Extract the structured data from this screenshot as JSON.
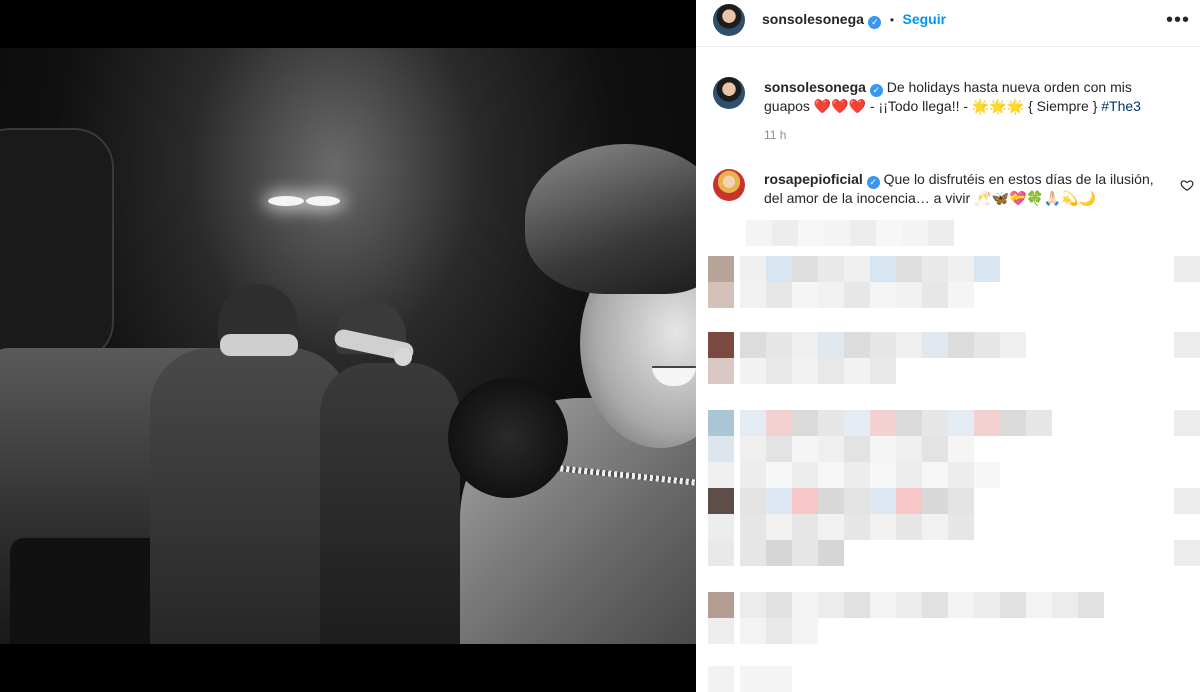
{
  "post": {
    "username": "sonsolesonega",
    "verified_mark": "✓",
    "separator": "•",
    "follow_label": "Seguir",
    "more_icon": "more-icon"
  },
  "caption": {
    "username": "sonsolesonega",
    "text": "De holidays hasta nueva orden con mis guapos ❤️❤️❤️ - ¡¡Todo llega!! - 🌟🌟🌟 { Siempre } ",
    "hashtag": "#The3",
    "time": "11 h"
  },
  "comments": [
    {
      "username": "rosapepioficial",
      "text": "Que lo disfrutéis en estos días de la ilusión, del amor de la inocencia… a vivir 🥂🦋💝🍀🙏🏻💫🌙"
    }
  ],
  "colors": {
    "accent": "#0095f6",
    "verified": "#3897f0",
    "text": "#262626",
    "muted": "#8e8e8e"
  }
}
